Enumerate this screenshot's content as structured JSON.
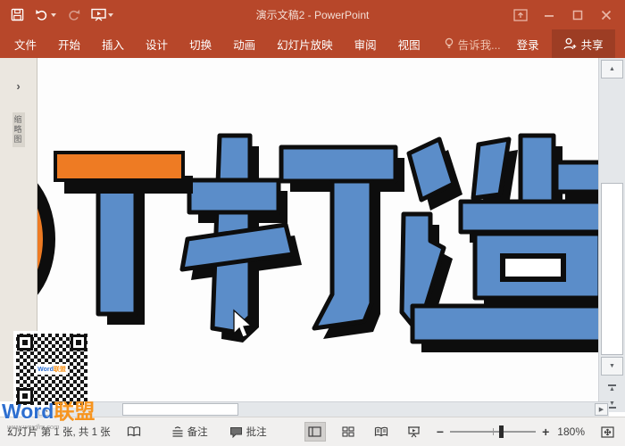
{
  "titlebar": {
    "title": "演示文稿2 - PowerPoint",
    "bg_color": "#B7472A"
  },
  "ribbon": {
    "tabs": [
      {
        "label": "文件"
      },
      {
        "label": "开始"
      },
      {
        "label": "插入"
      },
      {
        "label": "设计"
      },
      {
        "label": "切换"
      },
      {
        "label": "动画"
      },
      {
        "label": "幻灯片放映"
      },
      {
        "label": "审阅"
      },
      {
        "label": "视图"
      }
    ],
    "tell_me": "告诉我...",
    "sign_in": "登录",
    "share": "共享"
  },
  "left_pane": {
    "label": "缩略图"
  },
  "slide": {
    "visible_text": "T打造",
    "colors": {
      "text_blue": "#5B8DC9",
      "accent_orange": "#EE7B23",
      "outline_black": "#0D0D0D"
    },
    "zoom": "180%"
  },
  "watermark": {
    "qr_word": "Word",
    "qr_league": "联盟",
    "url": "www.wordlm.com"
  },
  "statusbar": {
    "slide_counter": "幻灯片 第 1 张, 共 1 张",
    "notes_label": "备注",
    "comments_label": "批注",
    "zoom_level": "180%"
  },
  "icons": {
    "pane_expand": "›",
    "arrow_up": "▲",
    "arrow_down": "▼",
    "arrow_left": "◀",
    "arrow_right": "▶",
    "zoom_out": "−",
    "zoom_in": "+"
  }
}
